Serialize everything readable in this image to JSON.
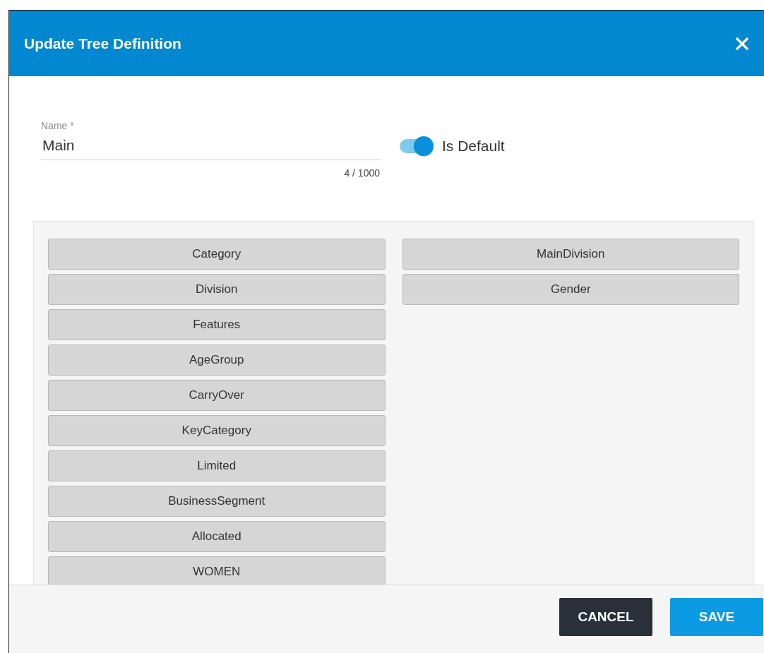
{
  "dialog": {
    "title": "Update Tree Definition"
  },
  "name_field": {
    "label": "Name *",
    "value": "Main",
    "counter": "4 / 1000"
  },
  "default_toggle": {
    "label": "Is Default",
    "on": true
  },
  "columns": [
    {
      "items": [
        "Category",
        "Division",
        "Features",
        "AgeGroup",
        "CarryOver",
        "KeyCategory",
        "Limited",
        "BusinessSegment",
        "Allocated",
        "WOMEN"
      ]
    },
    {
      "items": [
        "MainDivision",
        "Gender"
      ]
    }
  ],
  "buttons": [
    {
      "label": "CANCEL",
      "kind": "secondary"
    },
    {
      "label": "SAVE",
      "kind": "primary"
    }
  ]
}
